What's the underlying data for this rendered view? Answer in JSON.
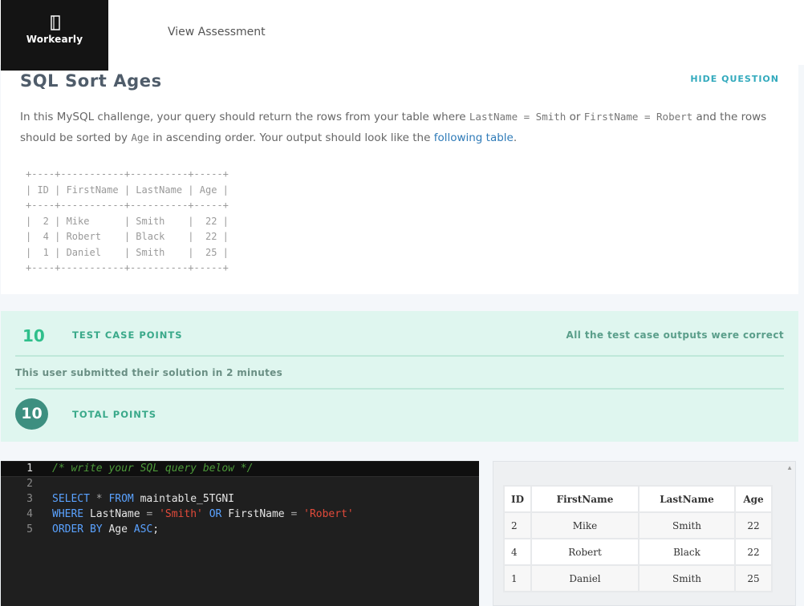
{
  "header": {
    "logo_text": "Workearly",
    "nav_link": "View Assessment"
  },
  "question": {
    "title": "SQL Sort Ages",
    "hide_label": "HIDE QUESTION",
    "text_1": "In this MySQL challenge, your query should return the rows from your table where ",
    "code_1": "LastName = Smith",
    "text_2": " or ",
    "code_2": "FirstName = Robert",
    "text_3": " and the rows should be sorted by ",
    "code_3": "Age",
    "text_4": " in ascending order. Your output should look like the ",
    "link_text": "following table",
    "text_5": ".",
    "ascii_table": "+----+-----------+----------+-----+\n| ID | FirstName | LastName | Age |\n+----+-----------+----------+-----+\n|  2 | Mike      | Smith    |  22 |\n|  4 | Robert    | Black    |  22 |\n|  1 | Daniel    | Smith    |  25 |\n+----+-----------+----------+-----+"
  },
  "points": {
    "test_case_points": "10",
    "test_case_label": "TEST CASE POINTS",
    "status": "All the test case outputs were correct",
    "submitted_text": "This user submitted their solution in 2 minutes",
    "total_points": "10",
    "total_label": "TOTAL POINTS"
  },
  "editor": {
    "line_numbers": [
      "1",
      "2",
      "3",
      "4",
      "5"
    ],
    "comment": "/* write your SQL query below */",
    "kw_select": "SELECT",
    "star": "*",
    "kw_from": "FROM",
    "table_name": "maintable_5TGNI",
    "kw_where": "WHERE",
    "col_lastname": "LastName",
    "eq": "=",
    "str_smith": "'Smith'",
    "kw_or": "OR",
    "col_firstname": "FirstName",
    "str_robert": "'Robert'",
    "kw_order_by": "ORDER BY",
    "col_age": "Age",
    "kw_asc": "ASC",
    "semicolon": ";"
  },
  "output": {
    "headers": [
      "ID",
      "FirstName",
      "LastName",
      "Age"
    ],
    "rows": [
      [
        "2",
        "Mike",
        "Smith",
        "22"
      ],
      [
        "4",
        "Robert",
        "Black",
        "22"
      ],
      [
        "1",
        "Daniel",
        "Smith",
        "25"
      ]
    ]
  },
  "colors": {
    "accent_teal": "#33aabd",
    "points_green": "#2fbf8b",
    "total_circle": "#3d8f80",
    "points_bg": "#dff6ef",
    "editor_bg": "#1f1f1f"
  },
  "icons": {
    "logo": "book-icon",
    "scroll": "scroll-up-arrow-icon"
  }
}
